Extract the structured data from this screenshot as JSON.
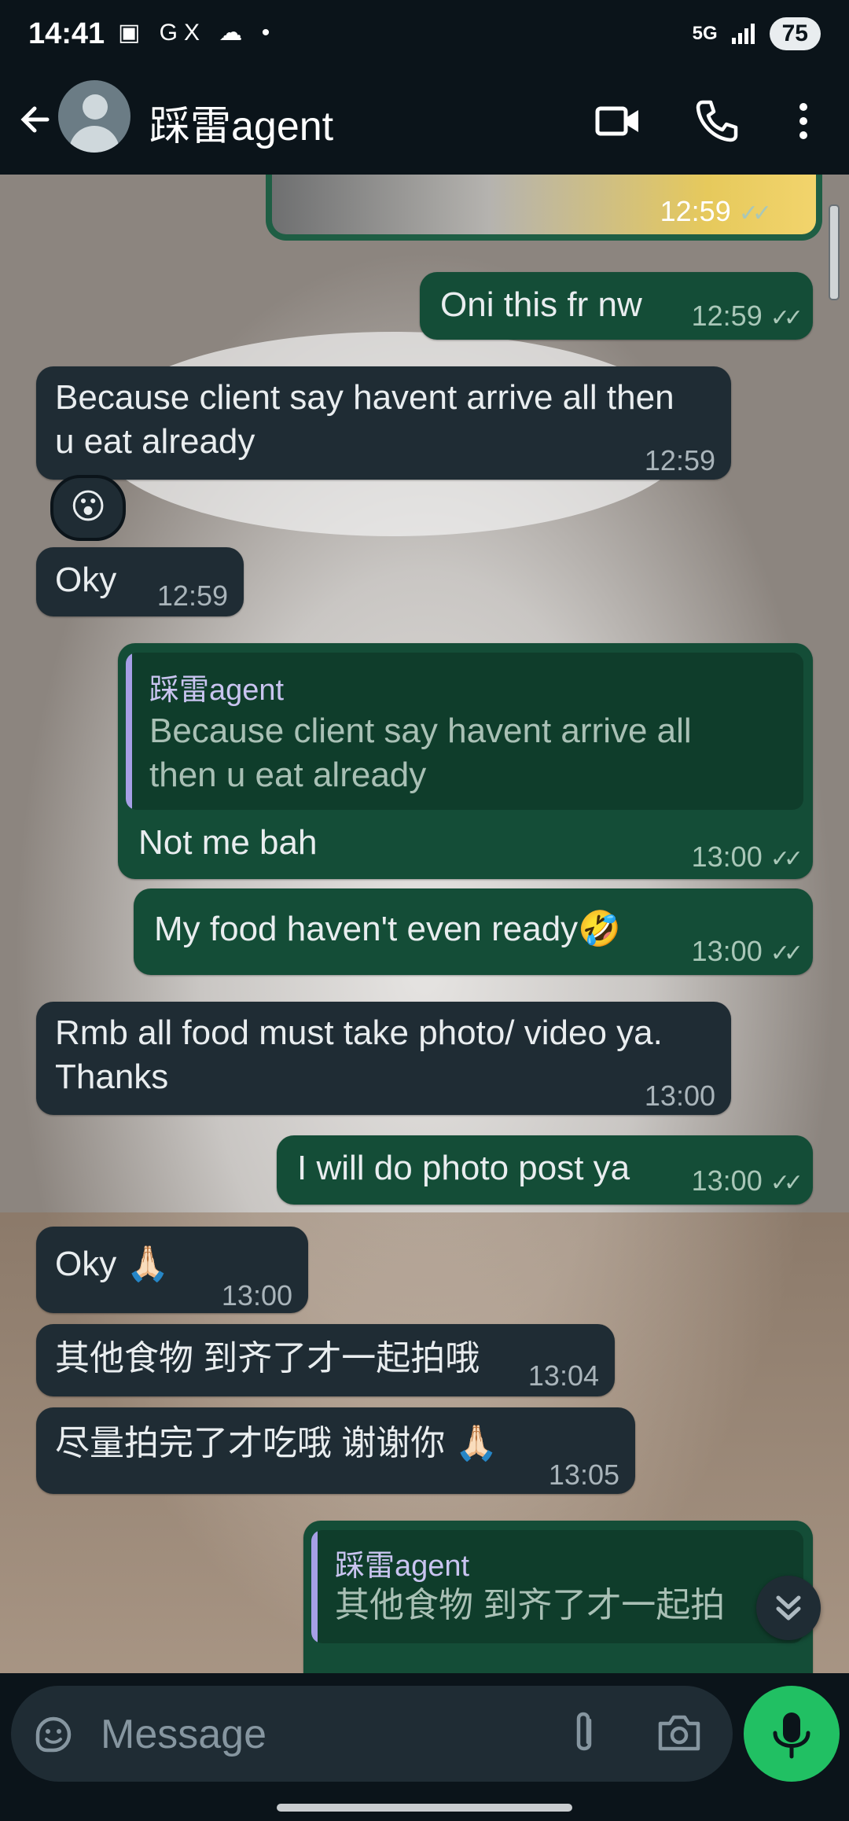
{
  "status_bar": {
    "time": "14:41",
    "left_icons": "▣ GX ☁ •",
    "network": "5G",
    "battery": "75"
  },
  "header": {
    "contact_name": "踩雷agent"
  },
  "messages": {
    "m1": {
      "text": "Oni this fr nw",
      "time": "12:59"
    },
    "photo": {
      "time": "12:59"
    },
    "m2": {
      "line1": "Because client say havent arrive all then",
      "line2": "u eat already",
      "time": "12:59"
    },
    "m2_reaction": "😮",
    "m3": {
      "text": "Oky",
      "time": "12:59"
    },
    "m4": {
      "quote_name": "踩雷agent",
      "quote_line1": "Because client say havent arrive all",
      "quote_line2": "then u eat already",
      "text": "Not me bah",
      "time": "13:00"
    },
    "m5": {
      "text": "My food haven't even ready🤣",
      "time": "13:00"
    },
    "m6": {
      "line1": "Rmb all food must take photo/ video ya.",
      "line2": "Thanks",
      "time": "13:00"
    },
    "m7": {
      "text": "I will do photo post ya",
      "time": "13:00"
    },
    "m8": {
      "text": "Oky 🙏🏻",
      "time": "13:00"
    },
    "m9": {
      "text": "其他食物 到齐了才一起拍哦",
      "time": "13:04"
    },
    "m10": {
      "text": "尽量拍完了才吃哦 谢谢你 🙏🏻",
      "time": "13:05"
    },
    "m11": {
      "quote_name": "踩雷agent",
      "quote_text": "其他食物 到齐了才一起拍"
    }
  },
  "composer": {
    "placeholder": "Message"
  },
  "colors": {
    "incoming": "#1f2c34",
    "outgoing": "#144d37",
    "mic": "#21c063"
  }
}
